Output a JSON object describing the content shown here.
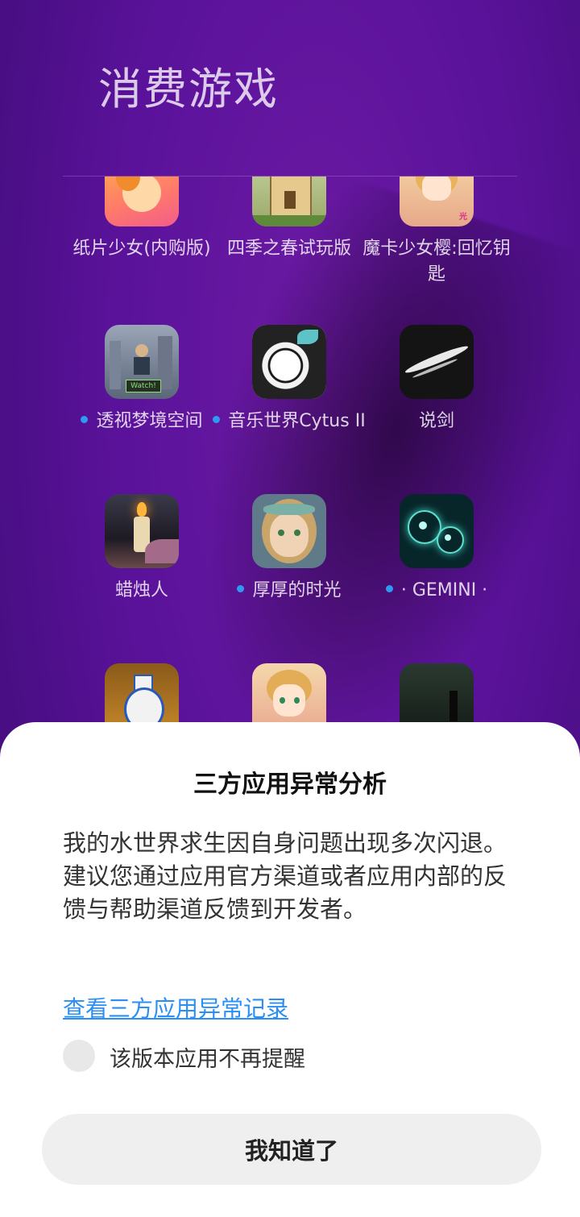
{
  "folder": {
    "title": "消费游戏",
    "apps": [
      {
        "label": "纸片少女(内购版)",
        "new": false,
        "icon": "paper-girl-icon"
      },
      {
        "label": "四季之春试玩版",
        "new": false,
        "icon": "spring-castle-icon"
      },
      {
        "label": "魔卡少女樱:回忆钥匙",
        "new": false,
        "icon": "cardcaptor-sakura-icon"
      },
      {
        "label": "透视梦境空间",
        "new": true,
        "icon": "dream-space-icon"
      },
      {
        "label": "音乐世界Cytus II",
        "new": true,
        "icon": "cytus-icon"
      },
      {
        "label": "说剑",
        "new": false,
        "icon": "sword-brush-icon"
      },
      {
        "label": "蜡烛人",
        "new": false,
        "icon": "candleman-icon"
      },
      {
        "label": "厚厚的时光",
        "new": true,
        "icon": "girl-portrait-icon"
      },
      {
        "label": "· GEMINI ·",
        "new": true,
        "icon": "gemini-icon"
      },
      {
        "label": "",
        "new": false,
        "icon": "blue-vase-icon"
      },
      {
        "label": "",
        "new": false,
        "icon": "cardcaptor-sakura-icon-2"
      },
      {
        "label": "",
        "new": false,
        "icon": "dark-scene-icon"
      }
    ]
  },
  "dialog": {
    "title": "三方应用异常分析",
    "message_line1": "我的水世界求生因自身问题出现多次闪退。",
    "message_line2": "建议您通过应用官方渠道或者应用内部的反馈与帮助渠道反馈到开发者。",
    "link": "查看三方应用异常记录",
    "checkbox_label": "该版本应用不再提醒",
    "button": "我知道了"
  },
  "colors": {
    "accent_link": "#2a8ff5",
    "new_dot": "#2e9bf0",
    "background": "#5a129a"
  }
}
